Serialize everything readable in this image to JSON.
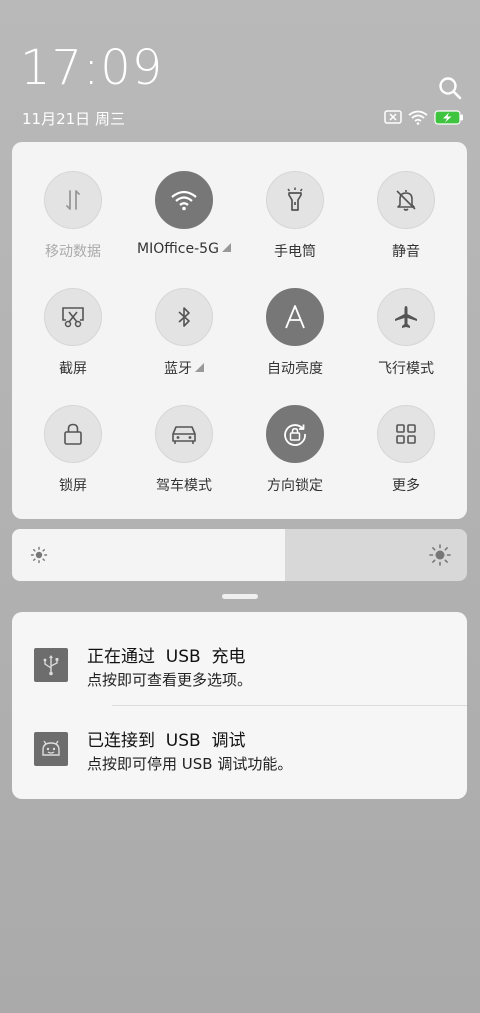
{
  "header": {
    "time": "17:09",
    "date": "11月21日 周三",
    "icons": [
      "search-icon",
      "no-sim-icon",
      "wifi-icon",
      "battery-charging-icon"
    ]
  },
  "quick_settings": {
    "tiles": [
      {
        "label": "移动数据",
        "icon": "mobile-data-icon",
        "active": false,
        "disabled": true
      },
      {
        "label": "MIOffice-5G",
        "icon": "wifi-icon",
        "active": true,
        "disabled": false
      },
      {
        "label": "手电筒",
        "icon": "flashlight-icon",
        "active": false,
        "disabled": false
      },
      {
        "label": "静音",
        "icon": "bell-off-icon",
        "active": false,
        "disabled": false
      },
      {
        "label": "截屏",
        "icon": "screenshot-icon",
        "active": false,
        "disabled": false
      },
      {
        "label": "蓝牙",
        "icon": "bluetooth-icon",
        "active": false,
        "disabled": false
      },
      {
        "label": "自动亮度",
        "icon": "auto-brightness-icon",
        "active": true,
        "disabled": false
      },
      {
        "label": "飞行模式",
        "icon": "airplane-icon",
        "active": false,
        "disabled": false
      },
      {
        "label": "锁屏",
        "icon": "lock-icon",
        "active": false,
        "disabled": false
      },
      {
        "label": "驾车模式",
        "icon": "car-icon",
        "active": false,
        "disabled": false
      },
      {
        "label": "方向锁定",
        "icon": "rotation-lock-icon",
        "active": true,
        "disabled": false
      },
      {
        "label": "更多",
        "icon": "grid-icon",
        "active": false,
        "disabled": false
      }
    ]
  },
  "brightness": {
    "level": 0.6
  },
  "notifications": [
    {
      "title": "正在通过  USB  充电",
      "text": "点按即可查看更多选项。",
      "icon": "usb-icon"
    },
    {
      "title": "已连接到  USB  调试",
      "text": "点按即可停用 USB 调试功能。",
      "icon": "android-debug-icon"
    }
  ],
  "colors": {
    "background": "#b3b3b3",
    "card": "#f4f4f4",
    "tile_off": "#e3e3e3",
    "tile_on": "#777777",
    "battery_green": "#3ec43e"
  }
}
